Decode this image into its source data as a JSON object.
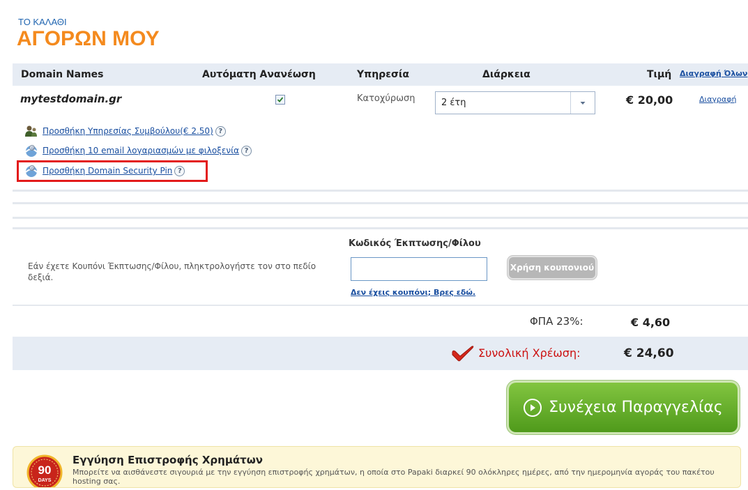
{
  "title_small": "ΤΟ ΚΑΛΑΘΙ",
  "title_big": "ΑΓΟΡΩΝ ΜΟΥ",
  "table": {
    "col_domain": "Domain Names",
    "col_renew": "Αυτόματη Ανανέωση",
    "col_service": "Υπηρεσία",
    "col_duration": "Διάρκεια",
    "col_price": "Τιμή",
    "delete_all": "Διαγραφή Όλων"
  },
  "item": {
    "domain": "mytestdomain.gr",
    "auto_renew_checked": true,
    "service": "Κατοχύρωση",
    "duration": "2 έτη",
    "price": "€ 20,00",
    "delete_label": "Διαγραφή"
  },
  "addons": [
    {
      "label": "Προσθήκη Υπηρεσίας Συμβούλου(€ 2.50)",
      "icon": "consultant-icon",
      "help": "?"
    },
    {
      "label": "Προσθήκη 10 email λογαριασμών με φιλοξενία",
      "icon": "email-icon",
      "help": "?"
    },
    {
      "label": "Προσθήκη Domain Security Pin",
      "icon": "security-pin-icon",
      "help": "?"
    }
  ],
  "coupon": {
    "label": "Κωδικός Έκπτωσης/Φίλου",
    "description": "Εάν έχετε Κουπόνι Έκπτωσης/Φίλου, πληκτρολογήστε τον στο πεδίο δεξιά.",
    "input_value": "",
    "button_label": "Χρήση κουπονιού",
    "link_label": "Δεν έχεις κουπόνι; Βρες εδώ."
  },
  "totals": {
    "vat_label": "ΦΠΑ 23%:",
    "vat_value": "€ 4,60",
    "total_label": "Συνολική Χρέωση:",
    "total_value": "€ 24,60"
  },
  "continue_label": "Συνέχεια Παραγγελίας",
  "guarantee": {
    "badge_number": "90",
    "badge_text": "DAYS",
    "title": "Εγγύηση Επιστροφής Χρημάτων",
    "text": "Μπορείτε να αισθάνεστε σιγουριά με την εγγύηση επιστροφής χρημάτων, η οποία στο Papaki διαρκεί 90 ολόκληρες ημέρες, από την ημερομηνία αγοράς του πακέτου hosting σας."
  },
  "colors": {
    "accent_orange": "#f48a1e",
    "header_blue": "#1f64b0",
    "row_bg": "#e6ecf4",
    "continue_green": "#5ea82a",
    "highlight_red": "#e31b1b",
    "total_red": "#cc1111"
  }
}
